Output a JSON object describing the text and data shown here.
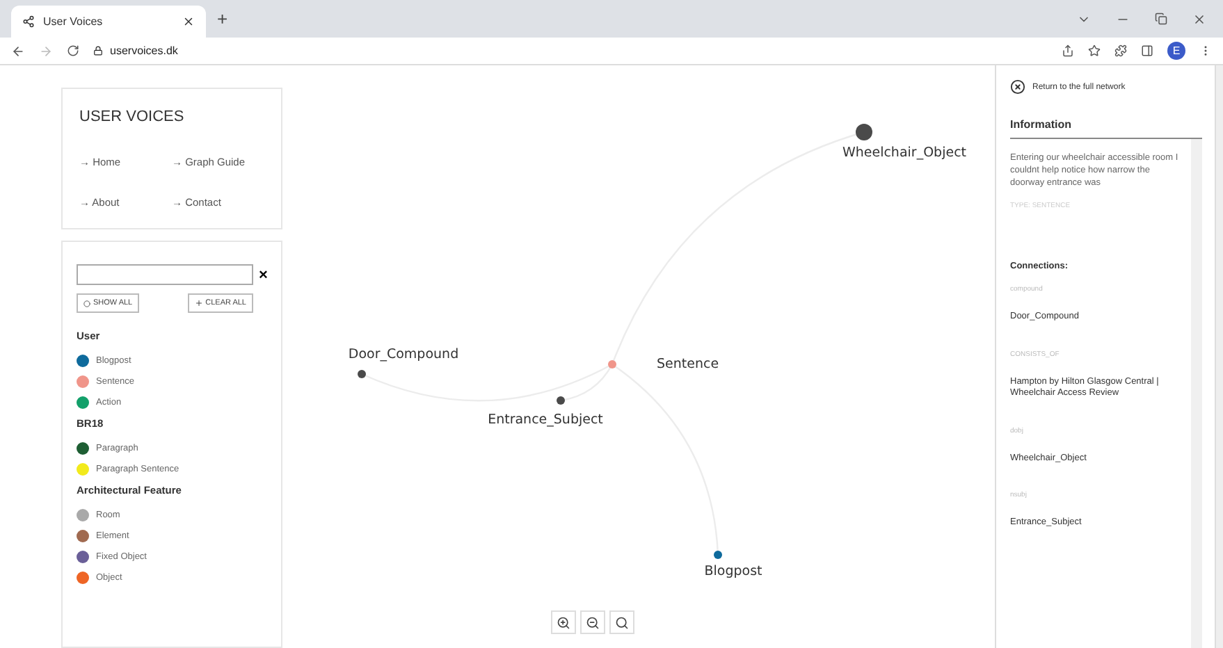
{
  "browser": {
    "tab_title": "User Voices",
    "new_tab": "+",
    "url": "uservoices.dk",
    "profile_initial": "E"
  },
  "site": {
    "title": "USER VOICES",
    "nav": [
      "→ Home",
      "→ Graph Guide",
      "→ About",
      "→ Contact"
    ]
  },
  "filter": {
    "clear_mark": "×",
    "show_all": "SHOW ALL",
    "clear_all": "CLEAR ALL"
  },
  "legend": [
    {
      "group": "User",
      "items": [
        {
          "label": "Blogpost",
          "color": "#0e6a9c"
        },
        {
          "label": "Sentence",
          "color": "#f0958a"
        },
        {
          "label": "Action",
          "color": "#13a06a"
        }
      ]
    },
    {
      "group": "BR18",
      "items": [
        {
          "label": "Paragraph",
          "color": "#1e5e33"
        },
        {
          "label": "Paragraph Sentence",
          "color": "#f2ea1c"
        }
      ]
    },
    {
      "group": "Architectural Feature",
      "items": [
        {
          "label": "Room",
          "color": "#a9a9a9"
        },
        {
          "label": "Element",
          "color": "#a06a50"
        },
        {
          "label": "Fixed Object",
          "color": "#6a5f98"
        },
        {
          "label": "Object",
          "color": "#ee6525"
        }
      ]
    }
  ],
  "graph": {
    "nodes": [
      {
        "label": "Wheelchair_Object",
        "color": "#4a4a4a"
      },
      {
        "label": "Door_Compound",
        "color": "#4a4a4a"
      },
      {
        "label": "Sentence",
        "color": "#f0958a"
      },
      {
        "label": "Entrance_Subject",
        "color": "#4a4a4a"
      },
      {
        "label": "Blogpost",
        "color": "#0e6a9c"
      }
    ]
  },
  "info": {
    "return_link": "Return to the full network",
    "heading": "Information",
    "text": "Entering our wheelchair accessible room I couldnt help notice how narrow the doorway entrance was",
    "type": "TYPE: SENTENCE",
    "connections_heading": "Connections:",
    "connections": [
      {
        "relation": "compound",
        "target": "Door_Compound"
      },
      {
        "relation": "CONSISTS_OF",
        "target": "Hampton by Hilton Glasgow Central | Wheelchair Access Review"
      },
      {
        "relation": "dobj",
        "target": "Wheelchair_Object"
      },
      {
        "relation": "nsubj",
        "target": "Entrance_Subject"
      }
    ]
  }
}
